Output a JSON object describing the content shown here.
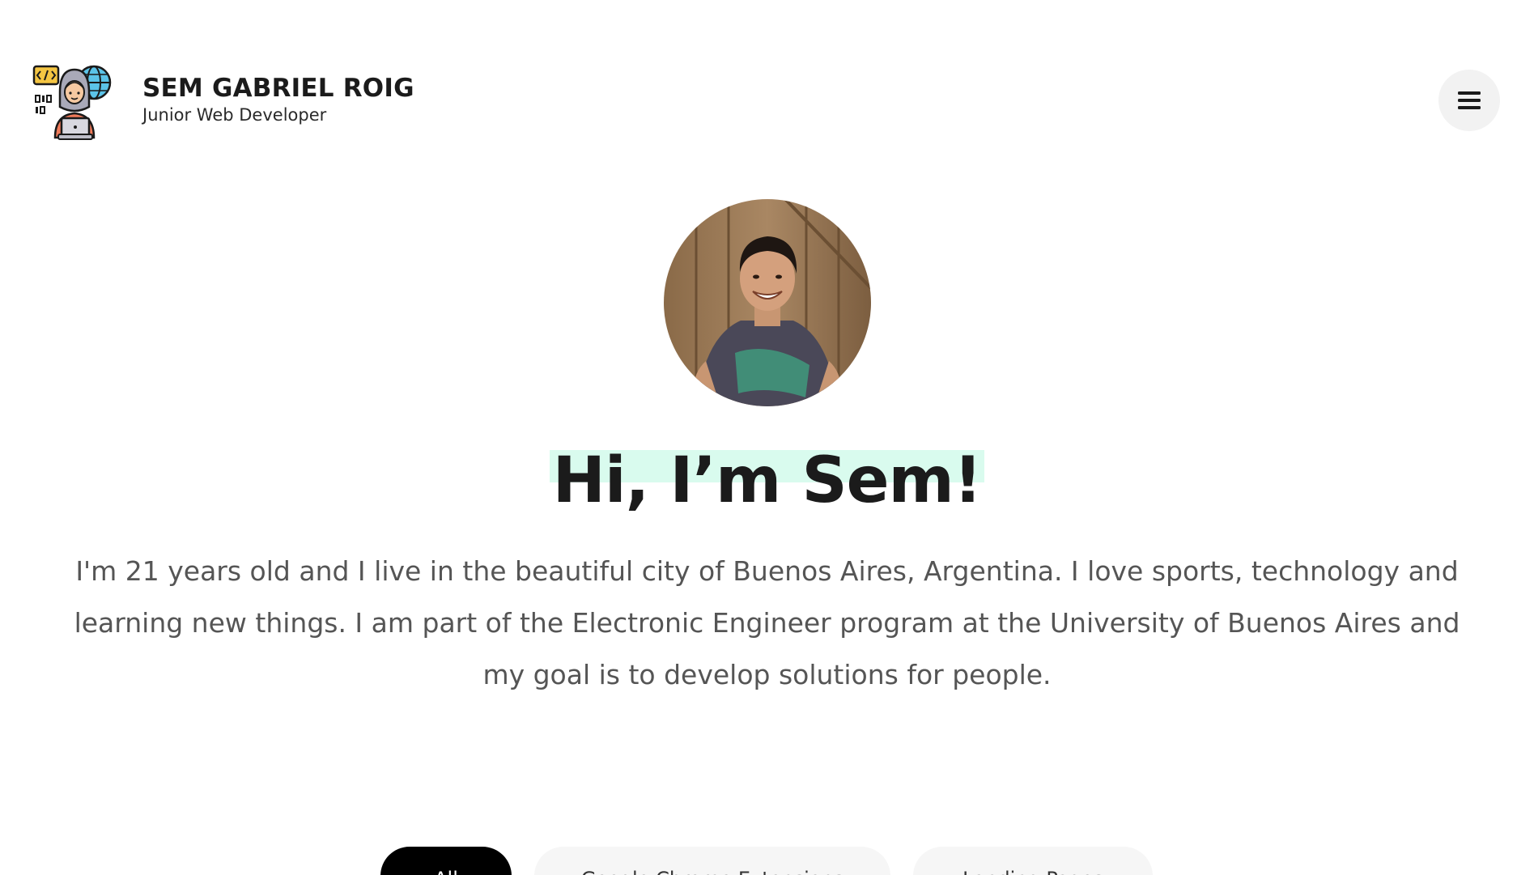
{
  "header": {
    "name": "SEM GABRIEL ROIG",
    "role": "Junior Web Developer",
    "menu_icon": "hamburger-menu-icon",
    "logo_icon": "developer-avatar-logo-icon"
  },
  "hero": {
    "avatar_icon": "profile-photo",
    "heading": "Hi, I’m Sem!",
    "bio": "I'm 21 years old and I live in the beautiful city of Buenos Aires, Argentina. I love sports, technology and learning new things. I am part of the Electronic Engineer program at the University of Buenos Aires and my goal is to develop solutions for people.",
    "highlight_color": "#d9fbee"
  },
  "filters": {
    "tabs": [
      {
        "label": "All",
        "active": true
      },
      {
        "label": "Google Chrome Extensions",
        "active": false
      },
      {
        "label": "Landing Pages",
        "active": false
      }
    ]
  },
  "colors": {
    "text": "#1b1b1b",
    "muted": "#555555",
    "active_tab": "#000000",
    "inactive_tab": "#f6f6f6",
    "menu_button": "#f2f2f2"
  }
}
